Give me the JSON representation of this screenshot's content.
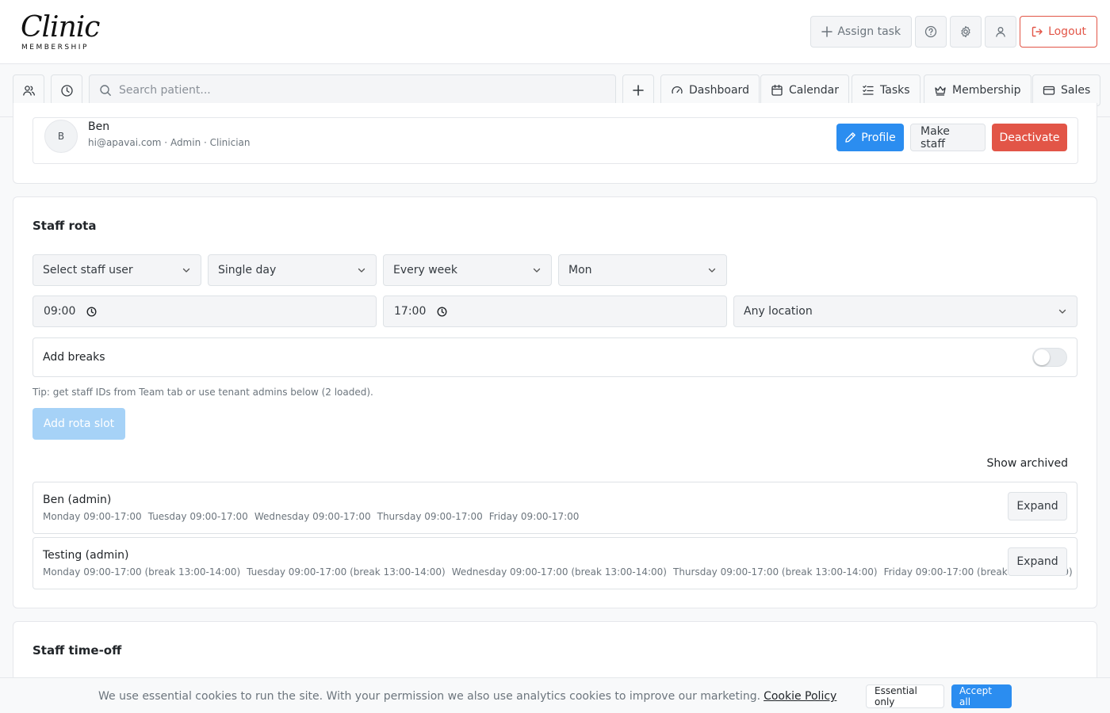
{
  "header": {
    "logo_script": "Clinic",
    "logo_sub": "MEMBERSHIP",
    "assign_task": "Assign task",
    "logout": "Logout"
  },
  "nav": {
    "search_placeholder": "Search patient...",
    "items": [
      {
        "label": "Dashboard",
        "icon": "gauge-icon"
      },
      {
        "label": "Calendar",
        "icon": "calendar-icon"
      },
      {
        "label": "Tasks",
        "icon": "tasks-icon"
      },
      {
        "label": "Membership",
        "icon": "crown-icon"
      },
      {
        "label": "Sales",
        "icon": "card-icon"
      }
    ]
  },
  "user": {
    "initial": "B",
    "name": "Ben",
    "meta": "hi@apavai.com · Admin · Clinician",
    "profile": "Profile",
    "make_staff": "Make staff",
    "deactivate": "Deactivate"
  },
  "rota": {
    "title": "Staff rota",
    "staff_select": "Select staff user",
    "day_mode": "Single day",
    "repeat": "Every week",
    "weekday": "Mon",
    "start": "09:00",
    "end": "17:00",
    "location": "Any location",
    "add_breaks": "Add breaks",
    "add_breaks_on": false,
    "tip": "Tip: get staff IDs from Team tab or use tenant admins below (2 loaded).",
    "add_slot": "Add rota slot",
    "show_archived": "Show archived",
    "expand": "Expand",
    "rows": [
      {
        "name": "Ben (admin)",
        "slots": [
          "Monday 09:00-17:00",
          "Tuesday 09:00-17:00",
          "Wednesday 09:00-17:00",
          "Thursday 09:00-17:00",
          "Friday 09:00-17:00"
        ]
      },
      {
        "name": "Testing (admin)",
        "slots": [
          "Monday 09:00-17:00 (break 13:00-14:00)",
          "Tuesday 09:00-17:00 (break 13:00-14:00)",
          "Wednesday 09:00-17:00 (break 13:00-14:00)",
          "Thursday 09:00-17:00 (break 13:00-14:00)",
          "Friday 09:00-17:00 (break 13:00-14:00)"
        ]
      }
    ]
  },
  "timeoff": {
    "title": "Staff time-off"
  },
  "cookie": {
    "text": "We use essential cookies to run the site. With your permission we also use analytics cookies to improve our marketing.",
    "link": "Cookie Policy",
    "essential": "Essential only",
    "accept": "Accept all"
  },
  "colors": {
    "primary": "#2b8df0",
    "danger": "#e25547",
    "disabled": "#a6d2f7"
  }
}
